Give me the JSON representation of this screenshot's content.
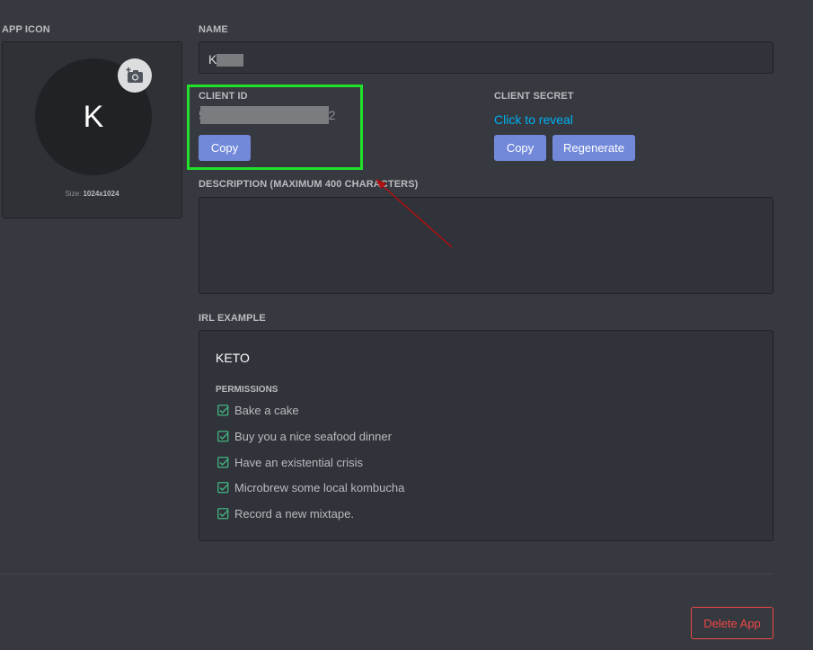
{
  "app_icon": {
    "label": "APP ICON",
    "avatar_letter": "K",
    "size_prefix": "Size: ",
    "size_value": "1024x1024",
    "camera_icon": "camera-plus-icon"
  },
  "name": {
    "label": "NAME",
    "value_visible": "K"
  },
  "client_id": {
    "label": "CLIENT ID",
    "value_start": "5",
    "value_end": "2",
    "copy_label": "Copy"
  },
  "client_secret": {
    "label": "CLIENT SECRET",
    "reveal_label": "Click to reveal",
    "copy_label": "Copy",
    "regenerate_label": "Regenerate"
  },
  "description": {
    "label": "DESCRIPTION (MAXIMUM 400 CHARACTERS)",
    "value": ""
  },
  "irl_example": {
    "label": "IRL EXAMPLE",
    "app_name": "KETO",
    "permissions_label": "PERMISSIONS",
    "permissions": [
      "Bake a cake",
      "Buy you a nice seafood dinner",
      "Have an existential crisis",
      "Microbrew some local kombucha",
      "Record a new mixtape."
    ],
    "check_icon": "checkbox-checked-icon"
  },
  "footer": {
    "delete_label": "Delete App"
  },
  "colors": {
    "background": "#36393f",
    "accent": "#7289da",
    "link": "#00b0f4",
    "danger": "#f04747",
    "check": "#43b581",
    "highlight": "#22e02a",
    "annotation_arrow": "#b01010"
  }
}
